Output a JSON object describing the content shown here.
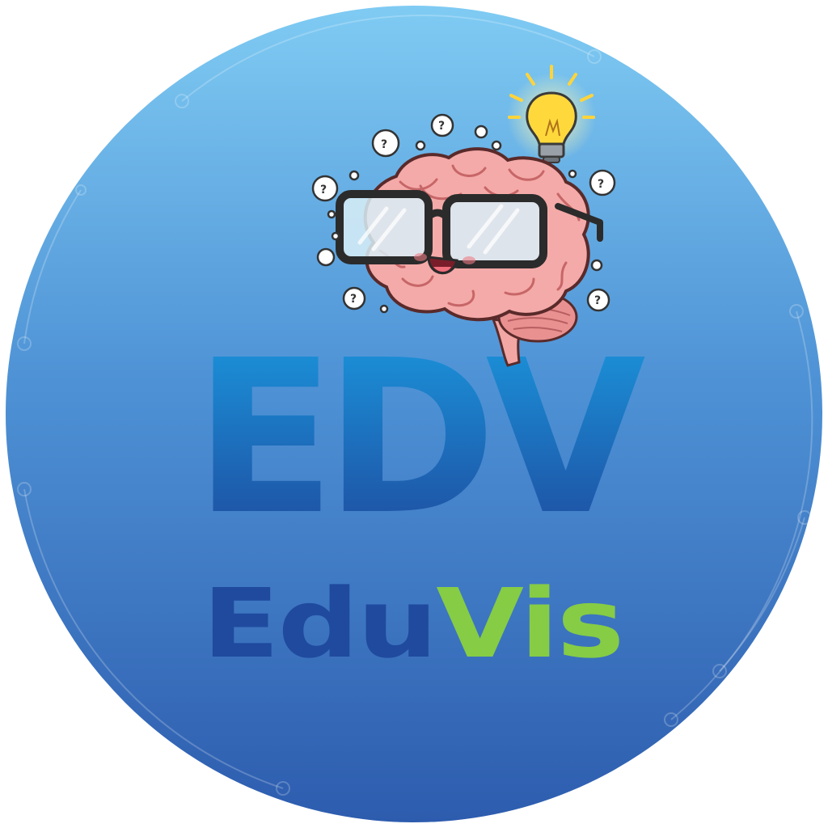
{
  "logo": {
    "monogram": "EDV",
    "wordmark_part1": "Edu",
    "wordmark_part2": "Vis",
    "bubble_mark": "?"
  },
  "colors": {
    "circle_top": "#7cc8f2",
    "circle_mid": "#4b92d6",
    "circle_bottom": "#2f5fb0",
    "monogram_top": "#1a95db",
    "monogram_bottom": "#1f4a9e",
    "wordmark_edu": "#1f4a9e",
    "wordmark_vis": "#86cc45",
    "brain": "#f2a7a5",
    "brain_dark": "#c96a6c",
    "glasses_frame": "#2b2b2b",
    "bulb": "#ffd93b"
  },
  "icons": [
    "brain-mascot-icon",
    "glasses-icon",
    "lightbulb-icon",
    "question-bubble-icon"
  ]
}
